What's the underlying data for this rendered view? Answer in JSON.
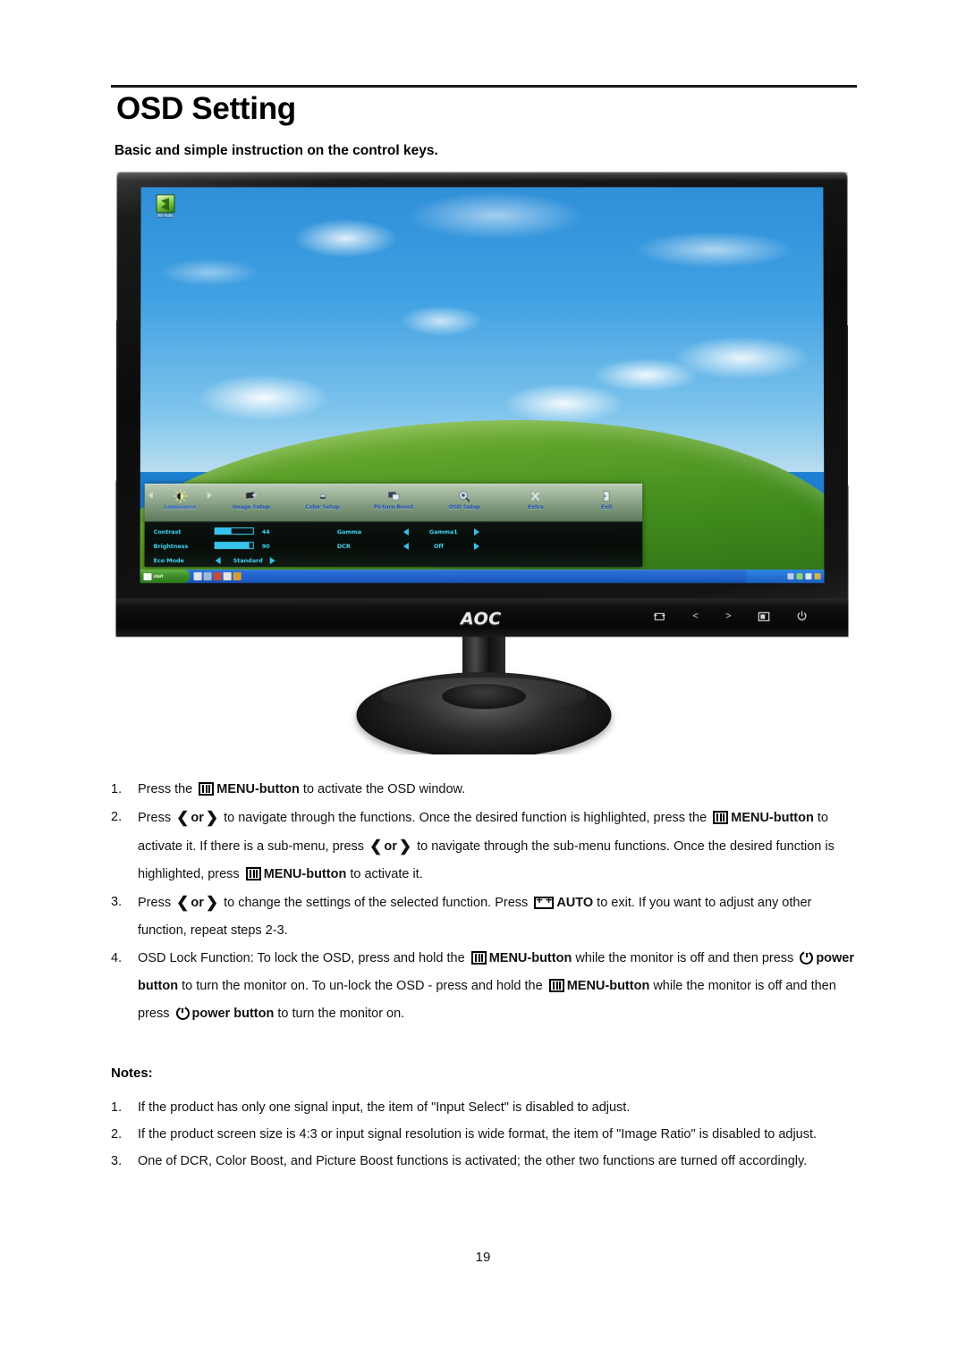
{
  "document": {
    "title": "OSD Setting",
    "subtitle": "Basic and simple instruction on the control keys.",
    "page_number": "19"
  },
  "monitor": {
    "brand_logo": "AOC",
    "desktop_icon_label": "我的电脑",
    "control_buttons": [
      {
        "name": "auto-input-button",
        "glyph": "⊞"
      },
      {
        "name": "left-button",
        "glyph": "<"
      },
      {
        "name": "right-button",
        "glyph": ">"
      },
      {
        "name": "menu-button",
        "glyph": "▥"
      },
      {
        "name": "power-button",
        "glyph": "⏻"
      }
    ],
    "taskbar": {
      "start_label": "start"
    }
  },
  "osd": {
    "tabs": [
      {
        "label": "Luminance",
        "active": true
      },
      {
        "label": "Image Setup",
        "active": false
      },
      {
        "label": "Color Setup",
        "active": false
      },
      {
        "label": "Picture Boost",
        "active": false
      },
      {
        "label": "OSD Setup",
        "active": false
      },
      {
        "label": "Extra",
        "active": false
      },
      {
        "label": "Exit",
        "active": false
      }
    ],
    "left_column": [
      {
        "label": "Contrast",
        "type": "slider",
        "value": "44",
        "percent": 44
      },
      {
        "label": "Brightness",
        "type": "slider",
        "value": "90",
        "percent": 90
      },
      {
        "label": "Eco Mode",
        "type": "select",
        "value": "Standard"
      }
    ],
    "right_column": [
      {
        "label": "Gamma",
        "type": "select",
        "value": "Gamma1"
      },
      {
        "label": "DCR",
        "type": "select",
        "value": "Off"
      }
    ]
  },
  "steps": [
    {
      "num": "1.",
      "parts": [
        {
          "t": "text",
          "v": "Press the "
        },
        {
          "t": "icon",
          "v": "menu-icon"
        },
        {
          "t": "bold",
          "v": "MENU-button"
        },
        {
          "t": "text",
          "v": " to activate the OSD window."
        }
      ]
    },
    {
      "num": "2.",
      "parts": [
        {
          "t": "text",
          "v": "Press "
        },
        {
          "t": "icon",
          "v": "left-chevron-icon"
        },
        {
          "t": "bold",
          "v": "or"
        },
        {
          "t": "icon",
          "v": "right-chevron-icon"
        },
        {
          "t": "text",
          "v": " to navigate through the functions. Once the desired function is highlighted, press the "
        },
        {
          "t": "icon",
          "v": "menu-icon"
        },
        {
          "t": "bold",
          "v": "MENU-button"
        },
        {
          "t": "text",
          "v": " to activate it. If there is a sub-menu, press "
        },
        {
          "t": "icon",
          "v": "left-chevron-icon"
        },
        {
          "t": "bold",
          "v": "or"
        },
        {
          "t": "icon",
          "v": "right-chevron-icon"
        },
        {
          "t": "text",
          "v": " to navigate through the sub-menu functions. Once the desired function is highlighted, press "
        },
        {
          "t": "icon",
          "v": "menu-icon"
        },
        {
          "t": "bold",
          "v": "MENU-button"
        },
        {
          "t": "text",
          "v": " to activate it."
        }
      ]
    },
    {
      "num": "3.",
      "parts": [
        {
          "t": "text",
          "v": "Press "
        },
        {
          "t": "icon",
          "v": "left-chevron-icon"
        },
        {
          "t": "bold",
          "v": "or"
        },
        {
          "t": "icon",
          "v": "right-chevron-icon"
        },
        {
          "t": "text",
          "v": " to change the settings of the selected function. Press "
        },
        {
          "t": "icon",
          "v": "auto-icon"
        },
        {
          "t": "bold",
          "v": "AUTO"
        },
        {
          "t": "text",
          "v": " to exit.   If you want to adjust any other function, repeat steps 2-3."
        }
      ]
    },
    {
      "num": "4.",
      "parts": [
        {
          "t": "text",
          "v": "OSD Lock Function: To lock the OSD, press and hold the "
        },
        {
          "t": "icon",
          "v": "menu-icon"
        },
        {
          "t": "bold",
          "v": "MENU-button"
        },
        {
          "t": "text",
          "v": " while the monitor is off and then press "
        },
        {
          "t": "icon",
          "v": "power-icon"
        },
        {
          "t": "bold",
          "v": "power button"
        },
        {
          "t": "text",
          "v": " to turn the monitor on. To un-lock the OSD - press and hold the "
        },
        {
          "t": "icon",
          "v": "menu-icon"
        },
        {
          "t": "bold",
          "v": "MENU-button"
        },
        {
          "t": "text",
          "v": " while the monitor is off and then press "
        },
        {
          "t": "icon",
          "v": "power-icon"
        },
        {
          "t": "bold",
          "v": "power button"
        },
        {
          "t": "text",
          "v": " to turn the monitor on."
        }
      ]
    }
  ],
  "notes": {
    "heading": "Notes:",
    "items": [
      {
        "num": "1.",
        "text": "If the product has only one signal input, the item of \"Input Select\" is disabled to adjust."
      },
      {
        "num": "2.",
        "text": "If the product screen size is 4:3 or input signal resolution is wide format, the item of \"Image Ratio\" is disabled to adjust."
      },
      {
        "num": "3.",
        "text": "One of DCR, Color Boost, and Picture Boost functions is activated; the other two functions are turned off accordingly."
      }
    ]
  },
  "colors": {
    "osd_text": "#43d4f2",
    "osd_tab_label": "#2a63d8",
    "osd_bar_fill": "#34c3ef",
    "taskbar_blue": "#2a6fd6",
    "start_green": "#3d8f28"
  }
}
